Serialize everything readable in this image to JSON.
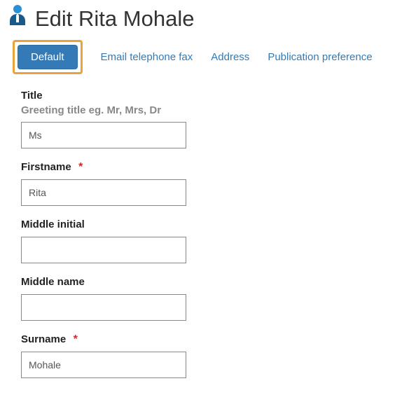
{
  "header": {
    "title": "Edit Rita Mohale"
  },
  "tabs": {
    "default": "Default",
    "email_tel_fax": "Email telephone fax",
    "address": "Address",
    "pub_pref": "Publication preference"
  },
  "fields": {
    "title": {
      "label": "Title",
      "hint": "Greeting title eg. Mr, Mrs, Dr",
      "value": "Ms"
    },
    "firstname": {
      "label": "Firstname",
      "value": "Rita"
    },
    "middle_initial": {
      "label": "Middle initial",
      "value": ""
    },
    "middle_name": {
      "label": "Middle name",
      "value": ""
    },
    "surname": {
      "label": "Surname",
      "value": "Mohale"
    }
  },
  "required_marker": "*"
}
